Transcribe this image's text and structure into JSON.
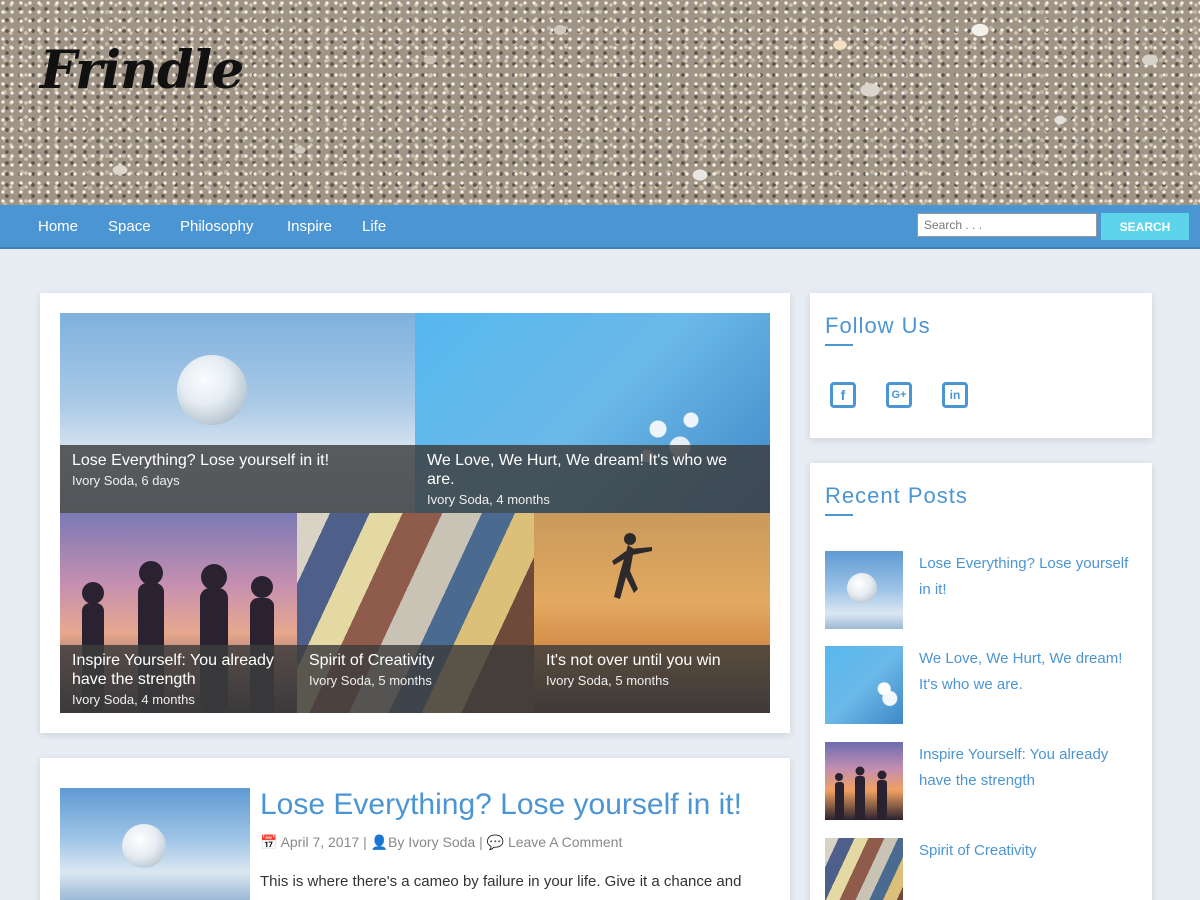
{
  "site": {
    "logo": "Frindle"
  },
  "nav": {
    "items": [
      {
        "label": "Home"
      },
      {
        "label": "Space"
      },
      {
        "label": "Philosophy"
      },
      {
        "label": "Inspire"
      },
      {
        "label": "Life"
      }
    ]
  },
  "search": {
    "placeholder": "Search . . .",
    "button_label": "Search"
  },
  "featured": [
    {
      "title": "Lose Everything? Lose yourself in it!",
      "meta": "Ivory Soda, 6 days"
    },
    {
      "title": "We Love, We Hurt, We dream! It's who we are.",
      "meta": "Ivory Soda, 4 months"
    },
    {
      "title": "Inspire Yourself: You already have the strength",
      "meta": "Ivory Soda, 4 months"
    },
    {
      "title": "Spirit of Creativity",
      "meta": "Ivory Soda, 5 months"
    },
    {
      "title": "It's not over until you win",
      "meta": "Ivory Soda, 5 months"
    }
  ],
  "follow": {
    "title": "Follow Us",
    "icons": [
      "facebook-icon",
      "google-plus-icon",
      "linkedin-icon"
    ],
    "glyphs": {
      "facebook": "f",
      "google": "G+",
      "linkedin": "in"
    }
  },
  "recent": {
    "title": "Recent Posts",
    "items": [
      {
        "title": "Lose Everything? Lose yourself in it!"
      },
      {
        "title": "We Love, We Hurt, We dream! It's who we are."
      },
      {
        "title": "Inspire Yourself: You already have the strength"
      },
      {
        "title": "Spirit of Creativity"
      }
    ]
  },
  "post": {
    "title": "Lose Everything? Lose yourself in it!",
    "date": "April 7, 2017",
    "author": "By Ivory Soda",
    "comments": "Leave A Comment",
    "separator": "|",
    "excerpt": "This is where there's a cameo by failure in your life. Give it a chance and"
  },
  "colors": {
    "accent": "#4c95d3",
    "search_button": "#5ed4ec",
    "background": "#e8edf4"
  }
}
